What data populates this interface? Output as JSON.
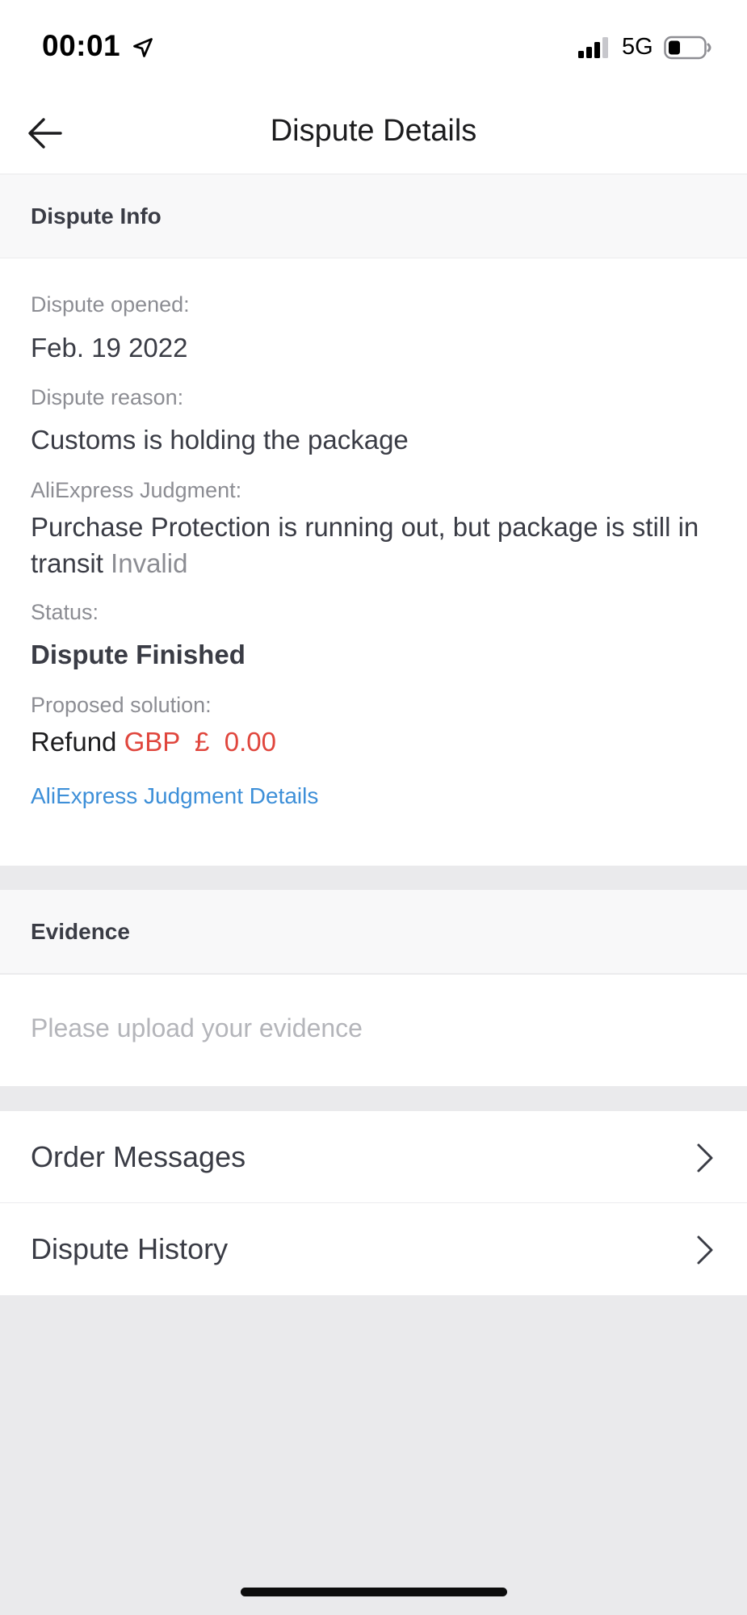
{
  "status_bar": {
    "time": "00:01",
    "network": "5G",
    "icons": [
      "location-arrow-icon",
      "cellular-signal-icon",
      "battery-icon"
    ]
  },
  "nav": {
    "back_icon": "arrow-left-icon",
    "title": "Dispute Details"
  },
  "dispute_info": {
    "section_title": "Dispute Info",
    "opened_label": "Dispute opened:",
    "opened_value": "Feb. 19 2022",
    "reason_label": "Dispute reason:",
    "reason_value": "Customs is holding the package",
    "judgment_label": "AliExpress Judgment:",
    "judgment_value": "Purchase Protection is running out, but package is still in transit",
    "judgment_result": "Invalid",
    "status_label": "Status:",
    "status_value": "Dispute Finished",
    "solution_label": "Proposed solution:",
    "solution_prefix": "Refund",
    "solution_amount": "GBP  £  0.00",
    "details_link": "AliExpress Judgment Details"
  },
  "evidence": {
    "section_title": "Evidence",
    "placeholder": "Please upload your evidence"
  },
  "links": [
    {
      "label": "Order Messages",
      "icon": "chevron-right-icon"
    },
    {
      "label": "Dispute History",
      "icon": "chevron-right-icon"
    }
  ],
  "colors": {
    "accent_red": "#e0463d",
    "link_blue": "#3d8fd8",
    "background": "#eaeaec"
  }
}
